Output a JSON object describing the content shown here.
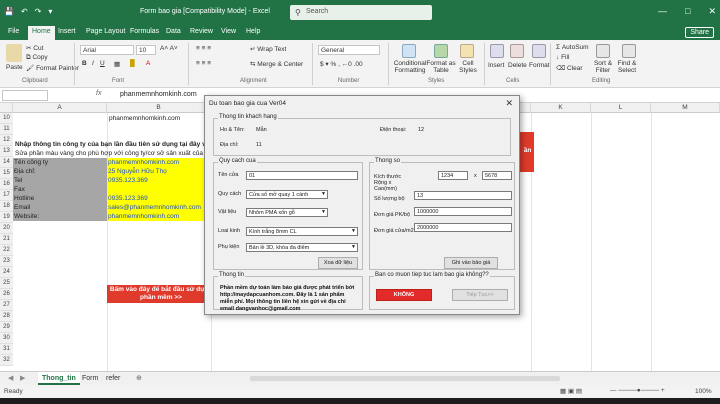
{
  "titlebar": {
    "autosave": "AutoSave",
    "title": "Form bao gia [Compatibility Mode] - Excel",
    "search_placeholder": "Search"
  },
  "menu": {
    "tabs": [
      "File",
      "Home",
      "Insert",
      "Page Layout",
      "Formulas",
      "Data",
      "Review",
      "View",
      "Help"
    ],
    "share": "Share"
  },
  "ribbon": {
    "paste": "Paste",
    "cut": "Cut",
    "copy": "Copy",
    "format_painter": "Format Painter",
    "clipboard": "Clipboard",
    "font_name": "Arial",
    "font_size": "10",
    "font": "Font",
    "wrap_text": "Wrap Text",
    "merge_center": "Merge & Center",
    "alignment": "Alignment",
    "number_format": "General",
    "number": "Number",
    "conditional_formatting": "Conditional Formatting",
    "format_as_table": "Format as Table",
    "cell_styles": "Cell Styles",
    "styles": "Styles",
    "insert": "Insert",
    "delete": "Delete",
    "format": "Format",
    "cells": "Cells",
    "autosum": "AutoSum",
    "fill": "Fill",
    "clear": "Clear",
    "sort_filter": "Sort & Filter",
    "find_select": "Find & Select",
    "editing": "Editing"
  },
  "formula_bar": {
    "fx": "fx",
    "value": "phanmemnhomkinh.com"
  },
  "grid": {
    "columns": [
      "A",
      "B",
      "C",
      "D",
      "E",
      "F",
      "G",
      "H",
      "I",
      "J",
      "K",
      "L",
      "M"
    ],
    "rows": [
      "10",
      "11",
      "12",
      "13",
      "14",
      "15",
      "16",
      "17",
      "18",
      "19",
      "20",
      "21",
      "22",
      "23",
      "24",
      "25",
      "26",
      "27",
      "28",
      "29",
      "30",
      "31",
      "32"
    ],
    "banner_url": "phanmemnhomkinh.com",
    "intro_line1": "Nhập thông tin công ty của bạn lần đầu tiên sử dụng tại đây và k",
    "intro_line2": "Sửa phần màu vàng cho phù hợp với công ty/cơ sở sản xuất của bạn",
    "company_rows": [
      {
        "label": "Tên công ty",
        "value": "phanmemnhomkinh.com"
      },
      {
        "label": "Địa chỉ:",
        "value": "25 Nguyễn Hữu Thọ"
      },
      {
        "label": "Tel",
        "value": "0935.123.369"
      },
      {
        "label": "Fax",
        "value": ""
      },
      {
        "label": "Hotline",
        "value": "0935.123.369"
      },
      {
        "label": "Email",
        "value": "sales@phanmemnhomkinh.com"
      },
      {
        "label": "Website:",
        "value": "phanmemnhomkinh.com"
      }
    ],
    "start_button": "Bấm vào đây để bắt đầu sử dụng phần mềm >>",
    "right_red_fragment": "ần"
  },
  "sheets": [
    "Thong_tin",
    "Form",
    "refer"
  ],
  "status": {
    "ready": "Ready",
    "zoom": "100%"
  },
  "dialog": {
    "title": "Du toan bao gia cua Ver04",
    "customer_frame": "Thong tin khach hang",
    "name_label": "Ho & Tên:",
    "name_value": "Mẫn",
    "phone_label": "Điện thoại:",
    "phone_value": "12",
    "address_label": "Địa chỉ:",
    "address_value": "11",
    "spec_frame": "Quy cach cua",
    "door_name_label": "Tên cửa",
    "door_name_value": "01",
    "spec_label": "Quy cách",
    "spec_value": "Cửa số mở quay 1 cánh",
    "material_label": "Vật liệu",
    "material_value": "Nhôm PMA xốn gỗ",
    "glass_label": "Loai kinh",
    "glass_value": "Kính trắng 8mm CL",
    "accessory_label": "Phụ kiện",
    "accessory_value": "Bản lề 3D, khóa đa điểm",
    "erase_button": "Xoa dữ liệu",
    "params_frame": "Thong so",
    "size_label": "Kích thước Rộng x Cao(mm)",
    "width_value": "1234",
    "times": "x",
    "height_value": "5678",
    "qty_label": "Số lượng bộ",
    "qty_value": "13",
    "unit_price_label": "Đơn giá PK/bộ",
    "unit_price_value": "1000000",
    "door_price_label": "Đơn giá cửa/m2",
    "door_price_value": "2000000",
    "save_button": "Ghi vào bảo giá",
    "info_frame": "Thong tin",
    "info_text": "Phần mềm dự toán làm báo giá được phát triển bởi http://maydapcuanhom.com. Đây là 1 sản phẩm miễn phí. Mọi thông tin liên hệ xin gửi về địa chỉ email dangvanhoc@gmail.com",
    "continue_frame": "Ban co muon tiep tuc lam bao gia không??",
    "no_button": "KHÔNG",
    "next_button": "Tiếp Tục>>"
  },
  "colors": {
    "excel_green": "#217346",
    "yellow_cell": "#ffff00",
    "gray_cell": "#a6a6a6",
    "red_button": "#e03a2c"
  }
}
